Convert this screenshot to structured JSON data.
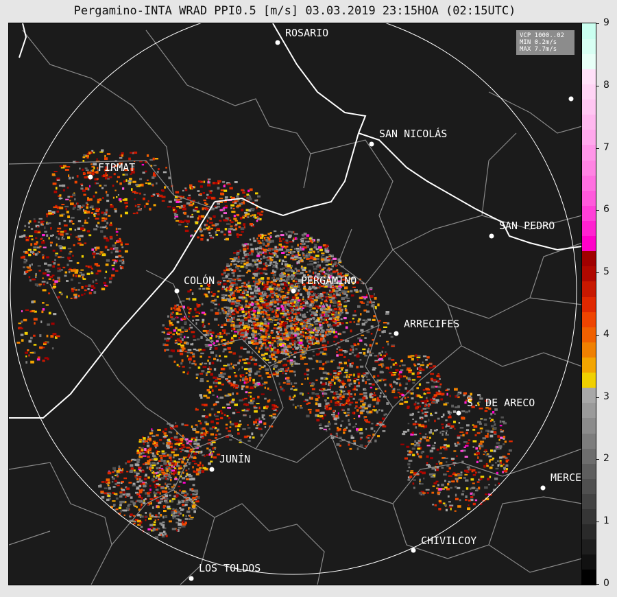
{
  "title": "Pergamino-INTA WRAD PPI0.5 [m/s] 03.03.2019 23:15HOA (02:15UTC)",
  "info_box": {
    "line1": "VCP 1000..02",
    "line2": "MIN 0.2m/s",
    "line3": "MAX 7.7m/s"
  },
  "cities": [
    {
      "id": "rosario",
      "name": "ROSARIO"
    },
    {
      "id": "san-nicolas",
      "name": "SAN NICOLÁS"
    },
    {
      "id": "firmat",
      "name": "FIRMAT"
    },
    {
      "id": "san-pedro",
      "name": "SAN PEDRO"
    },
    {
      "id": "colon",
      "name": "COLÓN"
    },
    {
      "id": "pergamino",
      "name": "PERGAMINO"
    },
    {
      "id": "arrecifes",
      "name": "ARRECIFES"
    },
    {
      "id": "s-de-areco",
      "name": "S. DE ARECO"
    },
    {
      "id": "junin",
      "name": "JUNÍN"
    },
    {
      "id": "mercedes",
      "name": "MERCE"
    },
    {
      "id": "chivilcoy",
      "name": "CHIVILCOY"
    },
    {
      "id": "los-toldos",
      "name": "LOS TOLDOS"
    }
  ],
  "colorbar": {
    "min": 0,
    "max": 9,
    "tick_labels": [
      "0",
      "1",
      "2",
      "3",
      "4",
      "5",
      "6",
      "7",
      "8",
      "9"
    ],
    "colors": [
      "#000000",
      "#111111",
      "#1e1e1e",
      "#2a2a2a",
      "#363636",
      "#434343",
      "#505050",
      "#5e5e5e",
      "#6d6d6d",
      "#7c7c7c",
      "#8b8b8b",
      "#9a9a9a",
      "#a8a8a8",
      "#f0d000",
      "#f3a500",
      "#f08000",
      "#f06000",
      "#ef4400",
      "#e02800",
      "#c81800",
      "#b00800",
      "#a00000",
      "#ff00c8",
      "#ff22d0",
      "#ff40d8",
      "#ff5adc",
      "#ff70e0",
      "#ff84e3",
      "#ff96e8",
      "#ffa8ec",
      "#ffb8ef",
      "#ffc6f2",
      "#ffd4f5",
      "#ffe0f8",
      "#e8fff7",
      "#d8fff3",
      "#cafff0"
    ]
  },
  "legend_colors": {
    "background": "#1b1b1b",
    "borders": "#8a8a8a",
    "rivers": "#ffffff",
    "range_ring": "#ffffff"
  }
}
